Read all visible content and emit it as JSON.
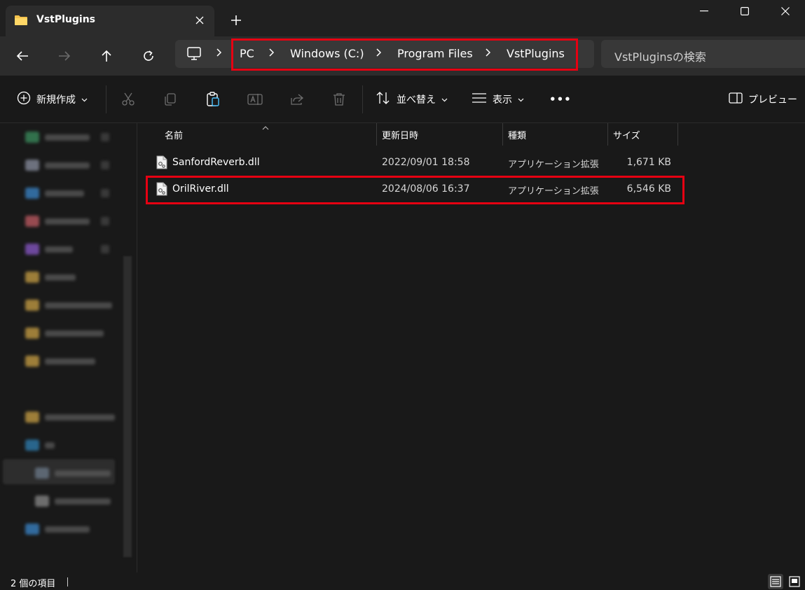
{
  "window": {
    "tab_title": "VstPlugins",
    "new_tab_label": "+"
  },
  "address": {
    "crumbs": [
      "PC",
      "Windows (C:)",
      "Program Files",
      "VstPlugins"
    ],
    "search_placeholder": "VstPluginsの検索"
  },
  "toolbar": {
    "new_label": "新規作成",
    "sort_label": "並べ替え",
    "view_label": "表示",
    "more_label": "•••",
    "preview_label": "プレビュー"
  },
  "columns": {
    "name": "名前",
    "modified": "更新日時",
    "type": "種類",
    "size": "サイズ"
  },
  "files": [
    {
      "name": "SanfordReverb.dll",
      "modified": "2022/09/01 18:58",
      "type": "アプリケーション拡張",
      "size": "1,671 KB"
    },
    {
      "name": "OrilRiver.dll",
      "modified": "2024/08/06 16:37",
      "type": "アプリケーション拡張",
      "size": "6,546 KB"
    }
  ],
  "status": {
    "item_count": "2 個の項目"
  },
  "colors": {
    "highlight": "#e60012",
    "folder": "#f4c24d"
  }
}
